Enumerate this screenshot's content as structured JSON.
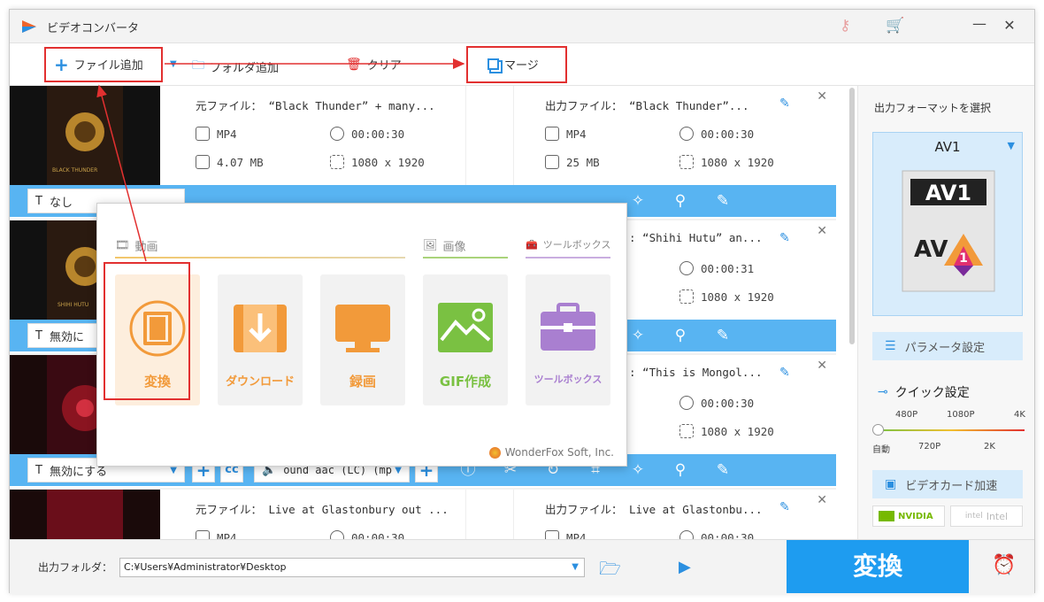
{
  "window": {
    "title": "ビデオコンバータ",
    "close": "✕",
    "minimize": "—"
  },
  "toolbar": {
    "add_file": "ファイル追加",
    "add_folder": "フォルダ追加",
    "clear": "クリア",
    "merge": "マージ"
  },
  "items": [
    {
      "src_name": "元ファイル： “Black Thunder” + many...",
      "dst_name": "出力ファイル： “Black Thunder”...",
      "src_fmt": "MP4",
      "src_dur": "00:00:30",
      "src_size": "4.07 MB",
      "src_res": "1080 x 1920",
      "dst_fmt": "MP4",
      "dst_dur": "00:00:30",
      "dst_size": "25 MB",
      "dst_res": "1080 x 1920",
      "subtitle": "なし",
      "poster_text": "BLACK THUNDER"
    },
    {
      "dst_name": ": “Shihi Hutu” an...",
      "dst_dur": "00:00:31",
      "dst_res": "1080 x 1920",
      "subtitle": "無効に",
      "poster_text": "SHIHI HUTU"
    },
    {
      "dst_name": ": “This is Mongol...",
      "dst_dur": "00:00:30",
      "dst_res": "1080 x 1920",
      "subtitle": "無効にする",
      "audio": "ound aac (LC) (mp"
    },
    {
      "src_name": "元ファイル： Live at Glastonbury out ...",
      "dst_name": "出力ファイル： Live at Glastonbu...",
      "src_fmt": "MP4",
      "src_dur": "00:00:30",
      "dst_fmt": "MP4",
      "dst_dur": "00:00:30"
    }
  ],
  "popup": {
    "section_video": "動画",
    "section_image": "画像",
    "section_toolbox": "ツールボックス",
    "tiles": [
      {
        "label": "変換",
        "color": "#f29a3a"
      },
      {
        "label": "ダウンロード",
        "color": "#f29a3a"
      },
      {
        "label": "録画",
        "color": "#f29a3a"
      },
      {
        "label": "GIF作成",
        "color": "#7ac142"
      },
      {
        "label": "ツールボックス",
        "color": "#a97fd0"
      }
    ],
    "brand": "WonderFox Soft, Inc."
  },
  "right_panel": {
    "format_title": "出力フォーマットを選択",
    "format": "AV1",
    "param_button": "パラメータ設定",
    "quick_title": "クイック設定",
    "q_top": [
      "480P",
      "1080P",
      "4K"
    ],
    "q_bottom": [
      "自動",
      "720P",
      "2K"
    ],
    "gpu_button": "ビデオカード加速",
    "nvidia": "NVIDIA",
    "intel": "Intel"
  },
  "bottom": {
    "output_label": "出力フォルダ：",
    "output_path": "C:¥Users¥Administrator¥Desktop",
    "convert": "変換"
  },
  "colors": {
    "accent": "#2b8fe0",
    "highlight": "#e23030",
    "bar": "#58b4f2",
    "convert_bg": "#1e9cf0"
  }
}
